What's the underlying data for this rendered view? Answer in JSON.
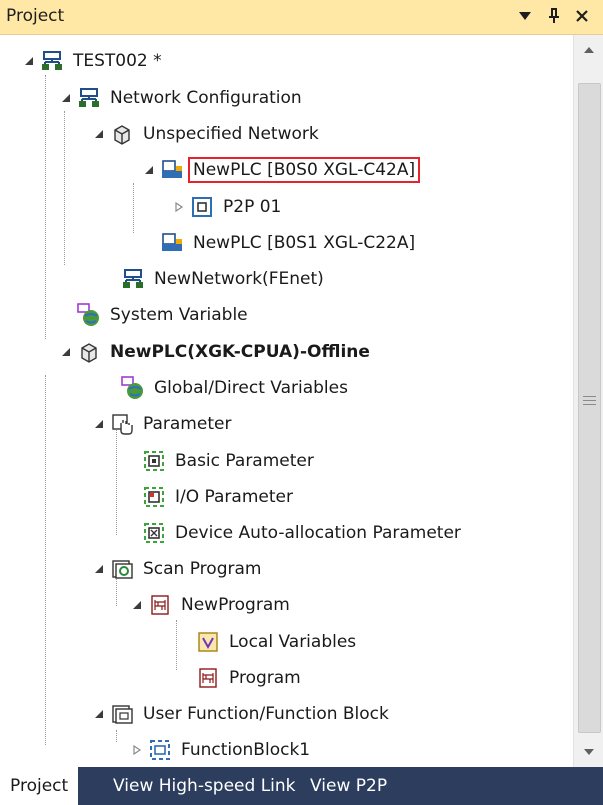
{
  "panel": {
    "title": "Project"
  },
  "titlebar_buttons": {
    "dropdown_icon": "▼",
    "pin_icon": "ᵖ",
    "close_icon": "✕"
  },
  "tree": {
    "root_label": "TEST002 *",
    "network_configuration": "Network Configuration",
    "unspecified_network": "Unspecified Network",
    "newplc_b0s0": "NewPLC [B0S0 XGL-C42A]",
    "p2p01": "P2P 01",
    "newplc_b0s1": "NewPLC [B0S1 XGL-C22A]",
    "newnetwork": "NewNetwork(FEnet)",
    "system_variable": "System Variable",
    "plc_offline": "NewPLC(XGK-CPUA)-Offline",
    "global_direct_variables": "Global/Direct Variables",
    "parameter": "Parameter",
    "basic_parameter": "Basic Parameter",
    "io_parameter": "I/O Parameter",
    "device_auto_allocation": "Device Auto-allocation Parameter",
    "scan_program": "Scan Program",
    "new_program": "NewProgram",
    "local_variables": "Local Variables",
    "program": "Program",
    "user_function_block": "User Function/Function Block",
    "function_block1": "FunctionBlock1"
  },
  "tabs": {
    "project": "Project",
    "high_speed_link": "View High-speed Link",
    "p2p": "View P2P"
  },
  "colors": {
    "titlebar": "#ffe8a6",
    "tabbar": "#2c3d5e",
    "selection_outline": "#e8222a"
  }
}
